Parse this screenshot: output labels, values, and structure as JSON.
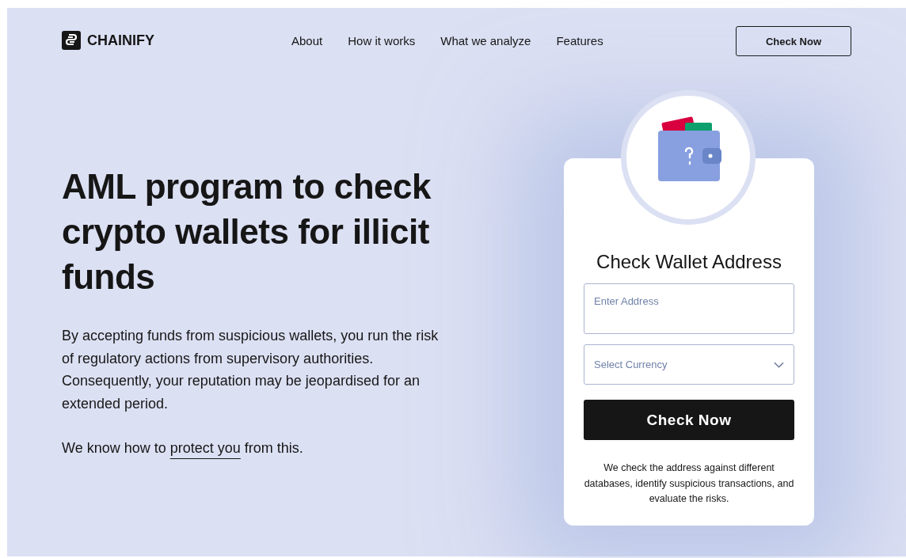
{
  "nav": {
    "logo": "CHAINIFY",
    "links": [
      "About",
      "How it works",
      "What we analyze",
      "Features"
    ],
    "cta": "Check Now"
  },
  "hero": {
    "title": "AML program to check crypto wallets for illicit funds",
    "paragraph": "By accepting funds from suspicious wallets, you run the risk of regulatory actions from supervisory authorities. Consequently, your reputation may be jeopardised for an extended period.",
    "tagline": {
      "before": "We know how to",
      "link": "protect you",
      "after": "from this."
    }
  },
  "card": {
    "title": "Check Wallet Address",
    "address_field": {
      "placeholder": "Enter Address"
    },
    "currency_select": {
      "placeholder": "Select Currency"
    },
    "button": "Check Now",
    "note": "We check the address against different databases, identify suspicious transactions, and evaluate the risks."
  }
}
